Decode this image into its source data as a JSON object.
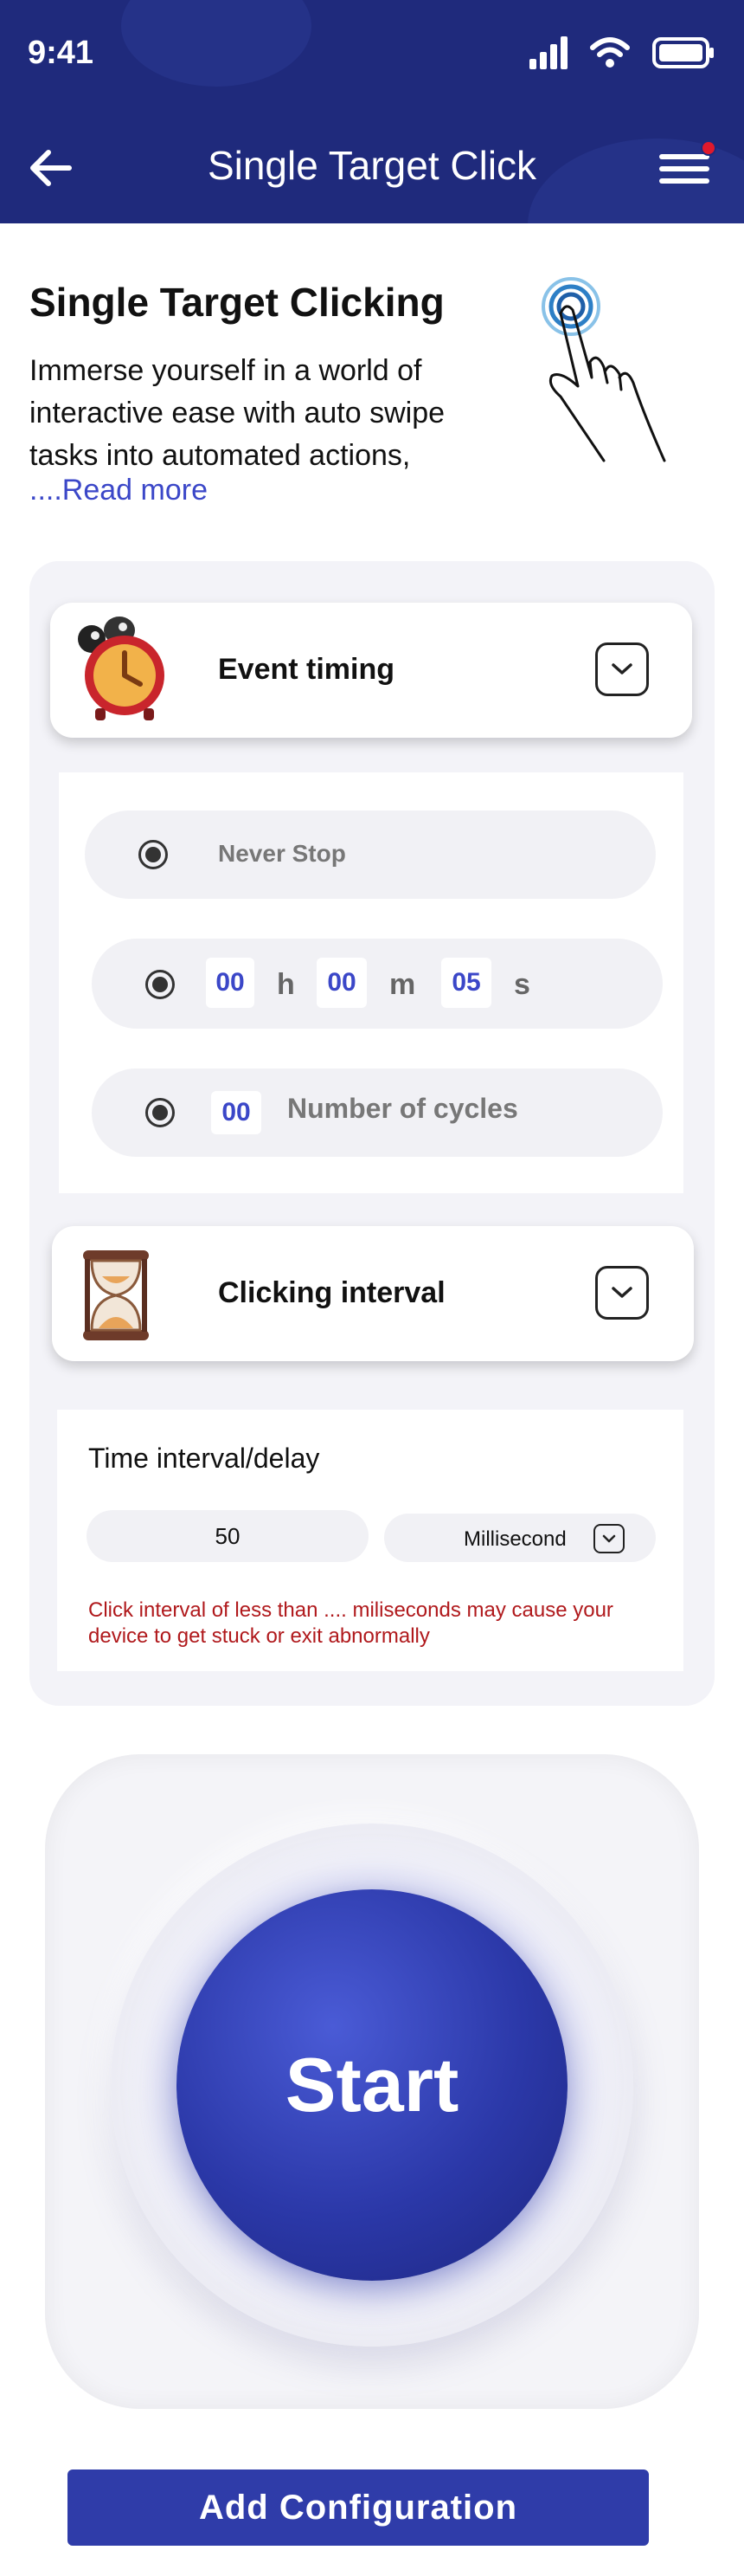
{
  "status_bar": {
    "time": "9:41"
  },
  "nav": {
    "title": "Single Target Click",
    "notification": true
  },
  "intro": {
    "title": "Single Target Clicking",
    "description": "Immerse yourself in a world of interactive ease with auto swipe tasks into automated actions,",
    "read_more": "....Read more"
  },
  "event_timing": {
    "title": "Event timing",
    "options": {
      "never_stop": "Never Stop",
      "hours": "00",
      "hours_unit": "h",
      "minutes": "00",
      "minutes_unit": "m",
      "seconds": "05",
      "seconds_unit": "s",
      "cycles": "00",
      "cycles_label": "Number of cycles"
    }
  },
  "clicking_interval": {
    "title": "Clicking interval",
    "delay_label": "Time interval/delay",
    "value": "50",
    "unit": "Millisecond",
    "warning": "Click interval of  less than .... miliseconds may cause your device to get stuck or exit abnormally"
  },
  "start": {
    "label": "Start"
  },
  "add_config": {
    "label": "Add Configuration"
  },
  "colors": {
    "header": "#1f2a7c",
    "accent": "#3b47c8",
    "button": "#2f3ca9",
    "warning": "#b0191c"
  }
}
